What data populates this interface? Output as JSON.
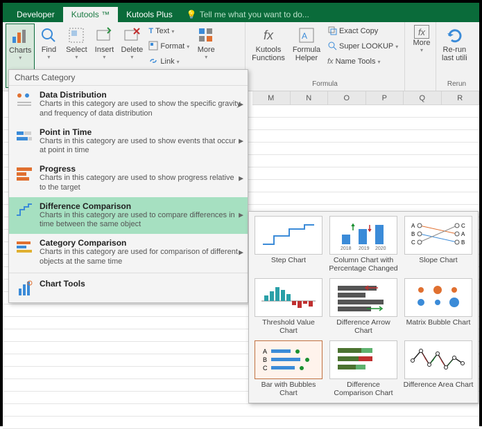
{
  "tabs": {
    "developer": "Developer",
    "kutools": "Kutools ™",
    "kutoolsplus": "Kutools Plus"
  },
  "tellme": "Tell me what you want to do...",
  "ribbon": {
    "charts": "Charts",
    "find": "Find",
    "select": "Select",
    "insert": "Insert",
    "delete": "Delete",
    "text": "Text",
    "format": "Format",
    "link": "Link",
    "more1": "More",
    "kutoolsfn": "Kutools\nFunctions",
    "formulahelper": "Formula\nHelper",
    "exactcopy": "Exact Copy",
    "superlookup": "Super LOOKUP",
    "nametools": "Name Tools",
    "more2": "More",
    "rerun": "Re-run\nlast utili",
    "grp_formula": "Formula",
    "grp_rerun": "Rerun"
  },
  "menu": {
    "header": "Charts Category",
    "items": [
      {
        "title": "Data Distribution",
        "desc": "Charts in this category are used to show the specific gravity and frequency of data distribution"
      },
      {
        "title": "Point in Time",
        "desc": "Charts in this category are used to show events that occur at point in time"
      },
      {
        "title": "Progress",
        "desc": "Charts in this category are used to show progress relative to the target"
      },
      {
        "title": "Difference Comparison",
        "desc": "Charts in this category are used to compare differences in time between the same object"
      },
      {
        "title": "Category Comparison",
        "desc": "Charts in this category are used for comparison of different objects at the same time"
      },
      {
        "title": "Chart Tools",
        "desc": ""
      }
    ]
  },
  "gallery": [
    "Step Chart",
    "Column Chart with Percentage Changed",
    "Slope Chart",
    "Threshold Value Chart",
    "Difference Arrow Chart",
    "Matrix Bubble Chart",
    "Bar with Bubbles Chart",
    "Difference Comparison Chart",
    "Difference Area Chart"
  ],
  "gallery_selected": 6,
  "columns": [
    "M",
    "N",
    "O",
    "P",
    "Q",
    "R"
  ]
}
